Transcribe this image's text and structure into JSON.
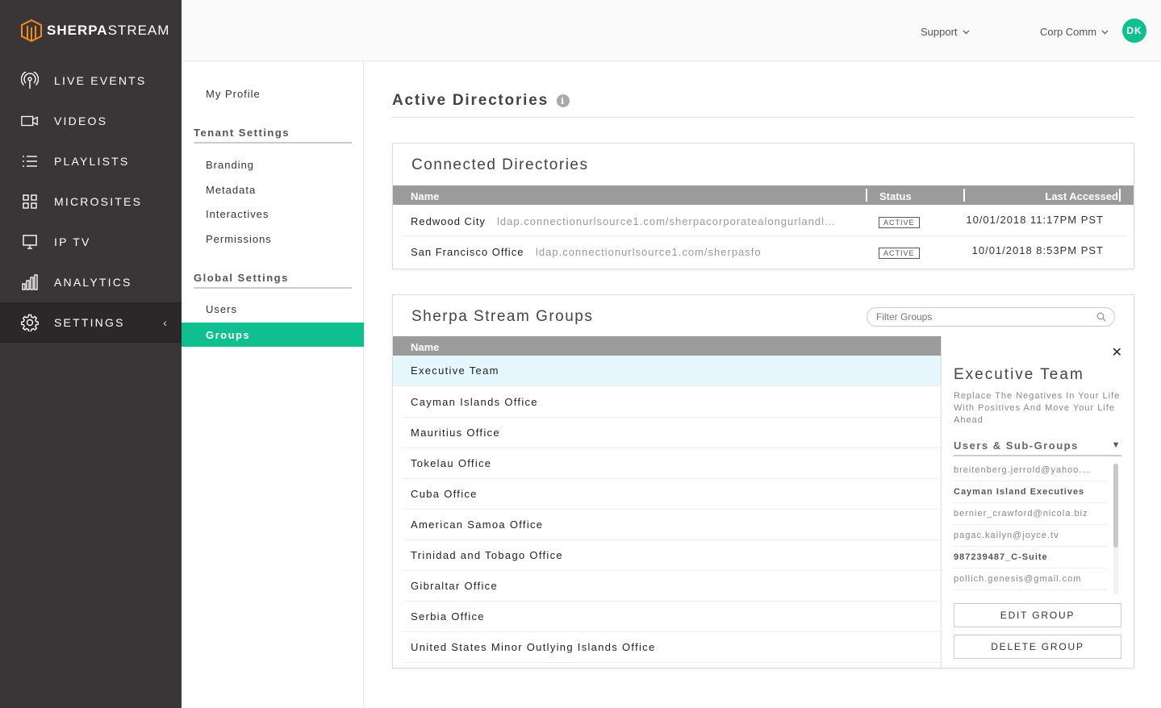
{
  "brand": {
    "name_bold": "SHERPA",
    "name_light": "STREAM"
  },
  "nav": [
    {
      "label": "LIVE EVENTS",
      "icon": "broadcast-icon"
    },
    {
      "label": "VIDEOS",
      "icon": "video-camera-icon"
    },
    {
      "label": "PLAYLISTS",
      "icon": "list-icon"
    },
    {
      "label": "MICROSITES",
      "icon": "grid-icon"
    },
    {
      "label": "IP TV",
      "icon": "monitor-icon"
    },
    {
      "label": "ANALYTICS",
      "icon": "bar-chart-icon"
    },
    {
      "label": "SETTINGS",
      "icon": "gear-icon",
      "active": true
    }
  ],
  "topbar": {
    "support": "Support",
    "account": "Corp Comm",
    "avatar_initials": "DK"
  },
  "subnav": {
    "my_profile": "My Profile",
    "tenant_heading": "Tenant Settings",
    "tenant_items": [
      "Branding",
      "Metadata",
      "Interactives",
      "Permissions"
    ],
    "global_heading": "Global Settings",
    "global_items": [
      "Users",
      "Groups"
    ],
    "active": "Groups"
  },
  "page": {
    "title": "Active Directories"
  },
  "connected": {
    "title": "Connected Directories",
    "columns": {
      "name": "Name",
      "status": "Status",
      "last_accessed": "Last Accessed"
    },
    "rows": [
      {
        "name": "Redwood City",
        "url": "ldap.connectionurlsource1.com/sherpacorporatealongurlandl…",
        "status": "ACTIVE",
        "last_accessed": "10/01/2018 11:17PM PST"
      },
      {
        "name": "San Francisco Office",
        "url": "ldap.connectionurlsource1.com/sherpasfo",
        "status": "ACTIVE",
        "last_accessed": "10/01/2018 8:53PM PST"
      }
    ]
  },
  "groups": {
    "title": "Sherpa Stream Groups",
    "filter_placeholder": "Filter Groups",
    "column_name": "Name",
    "rows": [
      "Executive Team",
      "Cayman Islands Office",
      "Mauritius Office",
      "Tokelau Office",
      "Cuba Office",
      "American Samoa Office",
      "Trinidad and Tobago Office",
      "Gibraltar Office",
      "Serbia Office",
      "United States Minor Outlying Islands Office"
    ],
    "selected": "Executive Team"
  },
  "detail": {
    "title": "Executive Team",
    "description": "Replace The Negatives In Your Life With Positives And Move Your Life Ahead",
    "members_heading": "Users & Sub-Groups",
    "members": [
      {
        "label": "breitenberg.jerrold@yahoo.…",
        "is_group": false
      },
      {
        "label": "Cayman Island Executives",
        "is_group": true
      },
      {
        "label": "bernier_crawford@nicola.biz",
        "is_group": false
      },
      {
        "label": "pagac.kailyn@joyce.tv",
        "is_group": false
      },
      {
        "label": "987239487_C-Suite",
        "is_group": true
      },
      {
        "label": "pollich.genesis@gmail.com",
        "is_group": false
      }
    ],
    "edit_label": "EDIT GROUP",
    "delete_label": "DELETE GROUP"
  },
  "colors": {
    "accent": "#0fbf8f",
    "nav_bg": "#3a3536",
    "table_header": "#9b9b9b",
    "selected_row": "#e5f7fd"
  }
}
